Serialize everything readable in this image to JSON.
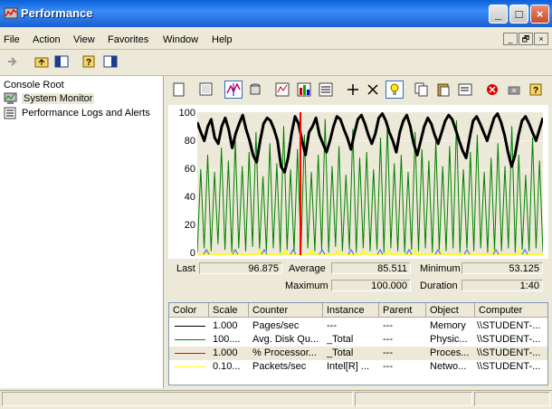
{
  "window": {
    "title": "Performance",
    "controls": [
      "_",
      "□",
      "×"
    ]
  },
  "menu": [
    "File",
    "Action",
    "View",
    "Favorites",
    "Window",
    "Help"
  ],
  "mdi_controls": [
    "_",
    "🗗",
    "×"
  ],
  "tree": {
    "root": "Console Root",
    "items": [
      "System Monitor",
      "Performance Logs and Alerts"
    ]
  },
  "values": {
    "last_label": "Last",
    "last": "96.875",
    "average_label": "Average",
    "average": "85.511",
    "minimum_label": "Minimum",
    "minimum": "53.125",
    "maximum_label": "Maximum",
    "maximum": "100.000",
    "duration_label": "Duration",
    "duration": "1:40"
  },
  "legend": {
    "headers": [
      "Color",
      "Scale",
      "Counter",
      "Instance",
      "Parent",
      "Object",
      "Computer"
    ],
    "rows": [
      {
        "color": "#000000",
        "scale": "1.000",
        "counter": "Pages/sec",
        "instance": "---",
        "parent": "---",
        "object": "Memory",
        "computer": "\\\\STUDENT-..."
      },
      {
        "color": "#008000",
        "scale": "100....",
        "counter": "Avg. Disk Qu...",
        "instance": "_Total",
        "parent": "---",
        "object": "Physic...",
        "computer": "\\\\STUDENT-..."
      },
      {
        "color": "#ff0000",
        "scale": "1.000",
        "counter": "% Processor...",
        "instance": "_Total",
        "parent": "---",
        "object": "Proces...",
        "computer": "\\\\STUDENT-..."
      },
      {
        "color": "#ffff00",
        "scale": "0.10...",
        "counter": "Packets/sec",
        "instance": "Intel[R] ...",
        "parent": "---",
        "object": "Netwo...",
        "computer": "\\\\STUDENT-..."
      }
    ]
  },
  "chart_data": {
    "type": "line",
    "ylim": [
      0,
      100
    ],
    "yticks": [
      "100",
      "80",
      "60",
      "40",
      "20",
      "0"
    ],
    "grid": true,
    "series": [
      {
        "name": "Pages/sec",
        "color": "#000000",
        "values": [
          93,
          86,
          80,
          90,
          95,
          82,
          78,
          90,
          96,
          88,
          75,
          85,
          92,
          98,
          88,
          80,
          70,
          65,
          80,
          92,
          96,
          94,
          88,
          80,
          62,
          58,
          68,
          85,
          97,
          92,
          80,
          70,
          86,
          90,
          96,
          84,
          78,
          72,
          80,
          90,
          97,
          95,
          88,
          82,
          74,
          85,
          95,
          98,
          92,
          84,
          78,
          85,
          96,
          99,
          94,
          86,
          80,
          72,
          86,
          94,
          98,
          90,
          78,
          70,
          80,
          90,
          96,
          92,
          84,
          78,
          86,
          94,
          98,
          95,
          88,
          80,
          73,
          68,
          82,
          94,
          97,
          92,
          86,
          80,
          88,
          96,
          99,
          93,
          84,
          72,
          62,
          70,
          84,
          94,
          97,
          92,
          86,
          80,
          88,
          96
        ]
      },
      {
        "name": "Avg. Disk Queue Length",
        "color": "#008000",
        "values": [
          2,
          60,
          5,
          70,
          3,
          58,
          8,
          75,
          4,
          66,
          2,
          80,
          5,
          62,
          3,
          72,
          6,
          86,
          4,
          55,
          3,
          78,
          5,
          64,
          2,
          90,
          4,
          60,
          3,
          74,
          2,
          84,
          5,
          58,
          3,
          70,
          4,
          95,
          2,
          62,
          6,
          76,
          3,
          56,
          4,
          88,
          2,
          68,
          5,
          72,
          3,
          60,
          4,
          82,
          2,
          92,
          5,
          64,
          3,
          70,
          2,
          58,
          4,
          86,
          3,
          74,
          5,
          66,
          2,
          80,
          4,
          62,
          3,
          76,
          5,
          94,
          2,
          60,
          4,
          72,
          3,
          84,
          5,
          58,
          2,
          68,
          4,
          78,
          3,
          62,
          5,
          90,
          2,
          70,
          4,
          56,
          3,
          82,
          5,
          66,
          2
        ]
      },
      {
        "name": "% Processor Time",
        "color": "#ff0000",
        "values": [
          0
        ]
      },
      {
        "name": "Packets/sec",
        "color": "#ffff00",
        "values": [
          0
        ]
      }
    ]
  }
}
